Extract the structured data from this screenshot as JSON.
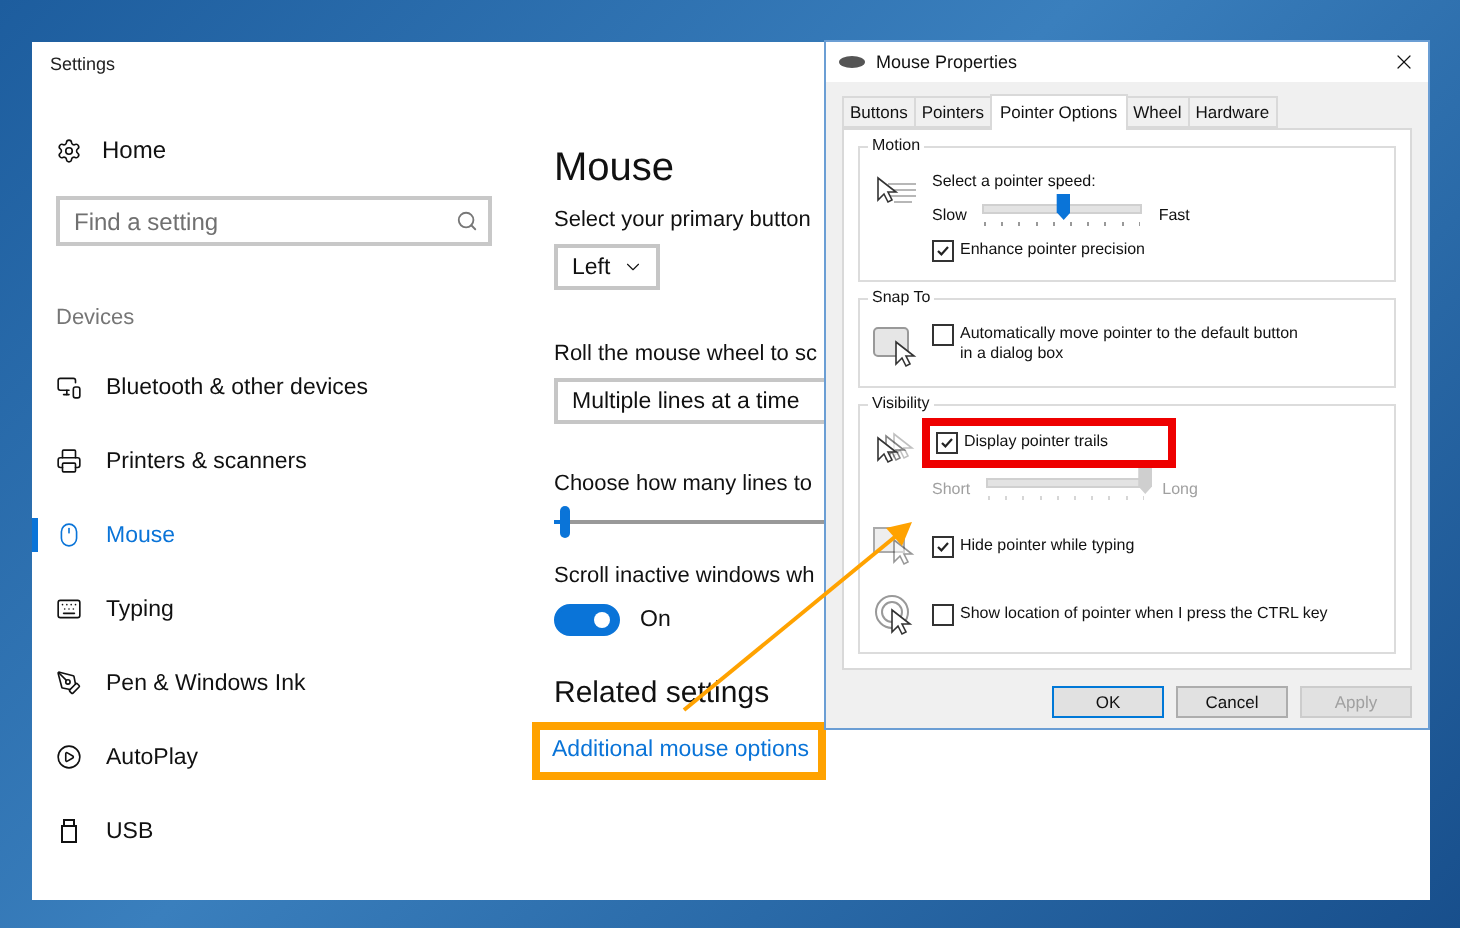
{
  "settings_window": {
    "title": "Settings",
    "sidebar": {
      "home": "Home",
      "search": {
        "placeholder": "Find a setting"
      },
      "section": "Devices",
      "items": [
        {
          "label": "Bluetooth & other devices",
          "selected": false
        },
        {
          "label": "Printers & scanners",
          "selected": false
        },
        {
          "label": "Mouse",
          "selected": true
        },
        {
          "label": "Typing",
          "selected": false
        },
        {
          "label": "Pen & Windows Ink",
          "selected": false
        },
        {
          "label": "AutoPlay",
          "selected": false
        },
        {
          "label": "USB",
          "selected": false
        }
      ]
    },
    "main": {
      "heading": "Mouse",
      "primary_button": {
        "label": "Select your primary button",
        "value": "Left"
      },
      "wheel": {
        "label": "Roll the mouse wheel to sc",
        "value": "Multiple lines at a time"
      },
      "lines": {
        "label": "Choose how many lines to",
        "level": 0.03
      },
      "inactive": {
        "label": "Scroll inactive windows wh",
        "on": true,
        "state": "On"
      },
      "related_heading": "Related settings",
      "related_link": "Additional mouse options"
    }
  },
  "dialog": {
    "title": "Mouse Properties",
    "tabs": [
      {
        "label": "Buttons",
        "selected": false
      },
      {
        "label": "Pointers",
        "selected": false
      },
      {
        "label": "Pointer Options",
        "selected": true
      },
      {
        "label": "Wheel",
        "selected": false
      },
      {
        "label": "Hardware",
        "selected": false
      }
    ],
    "motion": {
      "title": "Motion",
      "label": "Select a pointer speed:",
      "slow": "Slow",
      "fast": "Fast",
      "level": 0.5,
      "option": {
        "label": "Enhance pointer precision",
        "checked": true
      }
    },
    "snap_to": {
      "title": "Snap To",
      "option": {
        "label": "Automatically move pointer to the default button in a dialog box",
        "checked": false
      }
    },
    "visibility": {
      "title": "Visibility",
      "trails": {
        "label": "Display pointer trails",
        "checked": true
      },
      "trail_length": {
        "short": "Short",
        "long": "Long",
        "level": 1.0,
        "disabled": true
      },
      "hide": {
        "label": "Hide pointer while typing",
        "checked": true
      },
      "locate": {
        "label": "Show location of pointer when I press the CTRL key",
        "checked": false
      }
    },
    "buttons": [
      {
        "label": "OK",
        "default": true,
        "disabled": false
      },
      {
        "label": "Cancel",
        "default": false,
        "disabled": false
      },
      {
        "label": "Apply",
        "default": false,
        "disabled": true
      }
    ]
  }
}
